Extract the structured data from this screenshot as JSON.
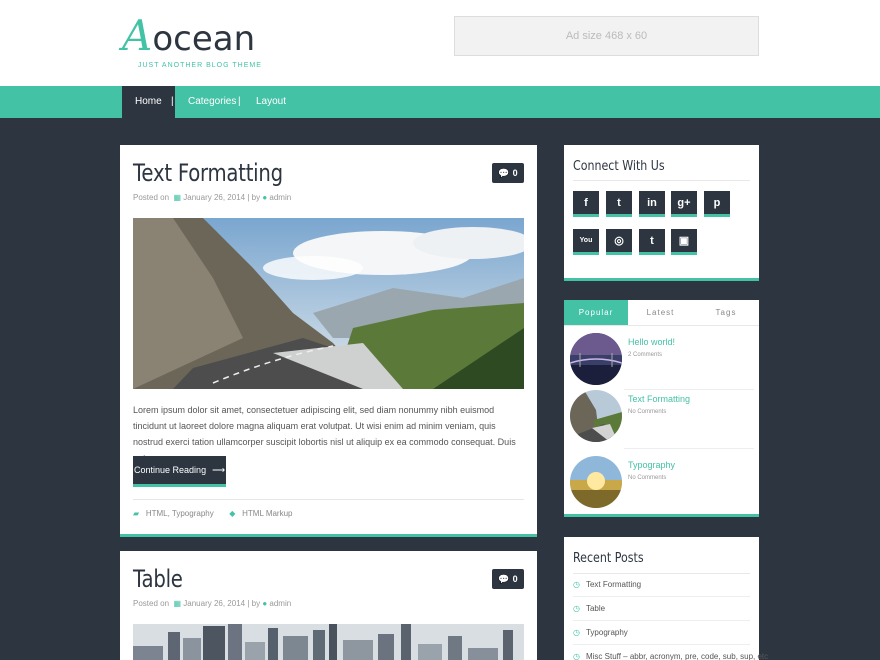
{
  "site": {
    "logo_main": "ocean",
    "logo_initial": "A",
    "tagline": "JUST ANOTHER BLOG THEME",
    "ad_text": "Ad size 468 x 60"
  },
  "nav": {
    "items": [
      {
        "label": "Home",
        "active": true
      },
      {
        "label": "Categories"
      },
      {
        "label": "Layout"
      }
    ],
    "separator": "|"
  },
  "posts": [
    {
      "title": "Text Formatting",
      "meta_prefix": "Posted on",
      "date": "January 26, 2014",
      "by": "| by",
      "author": "admin",
      "comments": "0",
      "excerpt": "Lorem ipsum dolor sit amet, consectetuer adipiscing elit, sed diam nonummy nibh euismod tincidunt ut laoreet dolore magna aliquam erat volutpat. Ut wisi enim ad minim veniam, quis nostrud exerci tation ullamcorper suscipit lobortis nisl ut aliquip ex ea commodo consequat. Duis autem",
      "button": "Continue Reading",
      "categories": "HTML, Typography",
      "tags": "HTML Markup"
    },
    {
      "title": "Table",
      "meta_prefix": "Posted on",
      "date": "January 26, 2014",
      "by": "| by",
      "author": "admin",
      "comments": "0"
    }
  ],
  "connect": {
    "title": "Connect With Us",
    "icons": [
      {
        "name": "facebook-icon",
        "glyph": "f"
      },
      {
        "name": "twitter-icon",
        "glyph": "t"
      },
      {
        "name": "linkedin-icon",
        "glyph": "in"
      },
      {
        "name": "googleplus-icon",
        "glyph": "g+"
      },
      {
        "name": "pinterest-icon",
        "glyph": "p"
      },
      {
        "name": "youtube-icon",
        "glyph": "You"
      },
      {
        "name": "dribbble-icon",
        "glyph": "◎"
      },
      {
        "name": "tumblr-icon",
        "glyph": "t"
      },
      {
        "name": "instagram-icon",
        "glyph": "▣"
      }
    ]
  },
  "tabs_widget": {
    "tabs": [
      {
        "label": "Popular",
        "active": true
      },
      {
        "label": "Latest"
      },
      {
        "label": "Tags"
      }
    ],
    "items": [
      {
        "title": "Hello world!",
        "sub": "2 Comments"
      },
      {
        "title": "Text Formatting",
        "sub": "No Comments"
      },
      {
        "title": "Typography",
        "sub": "No Comments"
      }
    ]
  },
  "recent": {
    "title": "Recent Posts",
    "items": [
      "Text Formatting",
      "Table",
      "Typography",
      "Misc Stuff – abbr, acronym, pre, code, sub, sup, etc"
    ]
  },
  "colors": {
    "accent": "#44c2a6",
    "dark": "#2d3640",
    "background": "#2d3640"
  }
}
